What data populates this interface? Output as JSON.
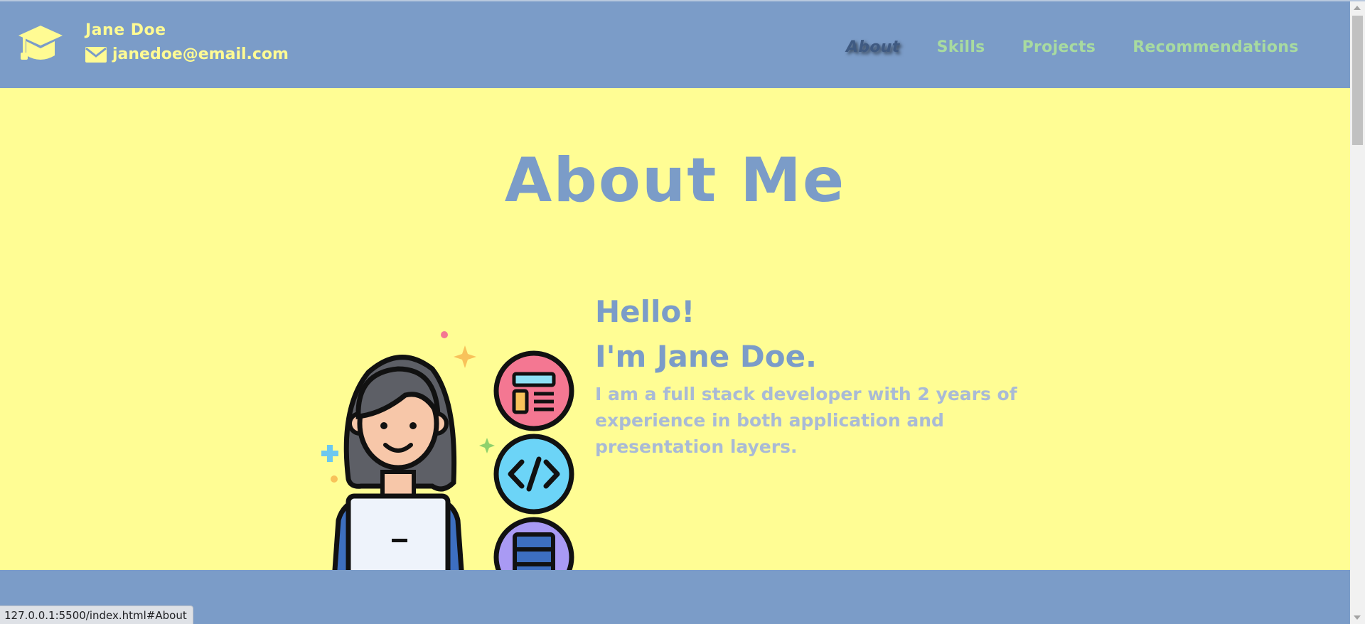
{
  "header": {
    "name": "Jane Doe",
    "email": "janedoe@email.com",
    "logo_icon": "graduation-cap-icon",
    "email_icon": "envelope-icon"
  },
  "nav": {
    "items": [
      {
        "label": "About",
        "active": true
      },
      {
        "label": "Skills",
        "active": false
      },
      {
        "label": "Projects",
        "active": false
      },
      {
        "label": "Recommendations",
        "active": false
      }
    ]
  },
  "about": {
    "title": "About Me",
    "greeting": "Hello!",
    "intro": "I'm Jane Doe.",
    "bio": "I am a full stack developer with 2 years of experience in both application and presentation layers."
  },
  "status_bar": {
    "url": "127.0.0.1:5500/index.html#About"
  },
  "colors": {
    "header_bg": "#7b9cc8",
    "main_bg": "#fffd94",
    "brand_text": "#fffb93",
    "nav_text": "#a8dba0",
    "heading_text": "#7b9cc8",
    "bio_text": "#a9bad6"
  }
}
